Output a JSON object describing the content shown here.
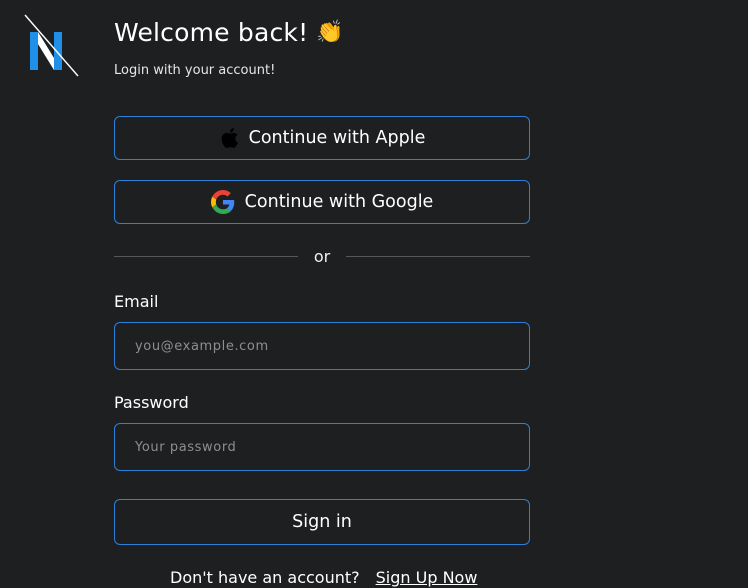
{
  "brand": {
    "logo_icon": "n-logo-icon",
    "accent": "#2d7fd8"
  },
  "header": {
    "title": "Welcome back!",
    "emoji": "👏",
    "subtitle": "Login with your account!"
  },
  "oauth": {
    "apple_label": "Continue with Apple",
    "apple_icon": "apple-icon",
    "google_label": "Continue with Google",
    "google_icon": "google-icon"
  },
  "divider": {
    "text": "or"
  },
  "form": {
    "email_label": "Email",
    "email_placeholder": "you@example.com",
    "email_value": "",
    "password_label": "Password",
    "password_placeholder": "Your password",
    "password_value": "",
    "submit_label": "Sign in"
  },
  "footer": {
    "prompt": "Don't have an account?",
    "signup_link": "Sign Up Now"
  }
}
